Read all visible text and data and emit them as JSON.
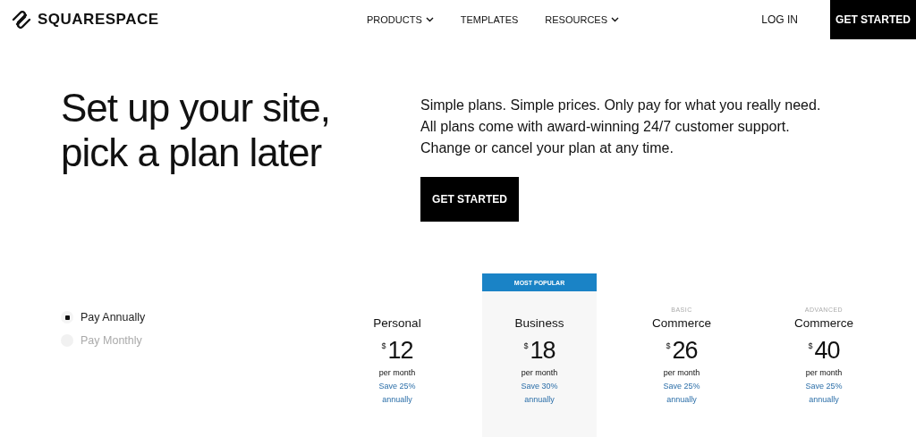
{
  "header": {
    "logo": "SQUARESPACE",
    "nav": [
      {
        "label": "PRODUCTS",
        "dropdown": true
      },
      {
        "label": "TEMPLATES",
        "dropdown": false
      },
      {
        "label": "RESOURCES",
        "dropdown": true
      }
    ],
    "login": "LOG IN",
    "cta": "GET STARTED"
  },
  "hero": {
    "title": "Set up your site, pick a plan later",
    "text": "Simple plans. Simple prices. Only pay for what you really need. All plans come with award-winning 24/7 customer support. Change or cancel your plan at any time.",
    "button": "GET STARTED"
  },
  "billing": [
    {
      "label": "Pay Annually",
      "selected": true
    },
    {
      "label": "Pay Monthly",
      "selected": false
    }
  ],
  "plans": [
    {
      "name": "Personal",
      "currency": "$",
      "price": "12",
      "period": "per month",
      "savings": "Save 25% annually"
    },
    {
      "badge": "MOST POPULAR",
      "name": "Business",
      "currency": "$",
      "price": "18",
      "period": "per month",
      "savings": "Save 30% annually"
    },
    {
      "tier": "BASIC",
      "name": "Commerce",
      "currency": "$",
      "price": "26",
      "period": "per month",
      "savings": "Save 25% annually"
    },
    {
      "tier": "ADVANCED",
      "name": "Commerce",
      "currency": "$",
      "price": "40",
      "period": "per month",
      "savings": "Save 25% annually"
    }
  ]
}
